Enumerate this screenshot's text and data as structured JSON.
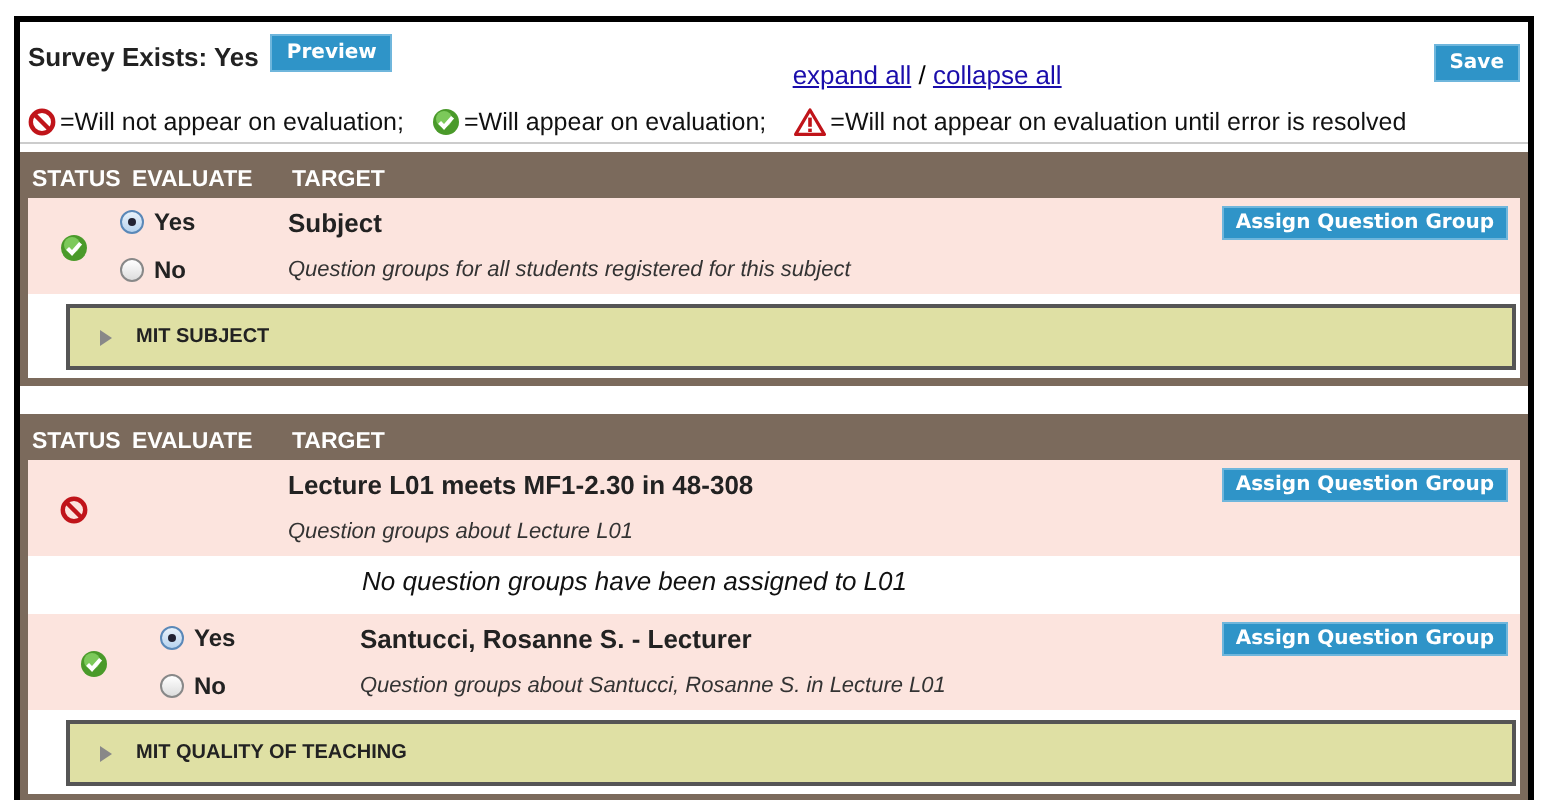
{
  "header": {
    "survey_status": "Survey Exists: Yes",
    "preview_button": "Preview",
    "expand_link": "expand all",
    "separator": "/",
    "collapse_link": "collapse all",
    "save_button": "Save"
  },
  "legend": [
    {
      "kind": "excluded",
      "text": "=Will not appear on evaluation;"
    },
    {
      "kind": "ok",
      "text": "=Will appear on evaluation;"
    },
    {
      "kind": "error",
      "text": "=Will not appear on evaluation until error is resolved"
    }
  ],
  "sections": [
    {
      "columns": [
        "STATUS",
        "EVALUATE",
        "TARGET"
      ],
      "targets": [
        {
          "kind": "ok",
          "options": [
            {
              "label": "Yes",
              "selected": true
            },
            {
              "label": "No",
              "selected": false
            }
          ],
          "title": "Subject",
          "description": "Question groups for all students registered for this subject",
          "button": "Assign Question Group",
          "groups": [
            {
              "label": "MIT SUBJECT",
              "expanded": false
            }
          ]
        }
      ]
    },
    {
      "columns": [
        "STATUS",
        "EVALUATE",
        "TARGET"
      ],
      "targets": [
        {
          "kind": "excluded",
          "title": "Lecture L01 meets MF1-2.30 in 48-308",
          "description": "Question groups about Lecture L01",
          "button": "Assign Question Group",
          "note": "No question groups have been assigned to L01",
          "children": [
            {
              "kind": "ok",
              "options": [
                {
                  "label": "Yes",
                  "selected": true
                },
                {
                  "label": "No",
                  "selected": false
                }
              ],
              "title": "Santucci, Rosanne S. - Lecturer",
              "description": "Question groups about Santucci, Rosanne S. in Lecture L01",
              "button": "Assign Question Group",
              "groups": [
                {
                  "label": "MIT QUALITY OF TEACHING",
                  "expanded": false
                }
              ]
            }
          ]
        }
      ]
    }
  ]
}
